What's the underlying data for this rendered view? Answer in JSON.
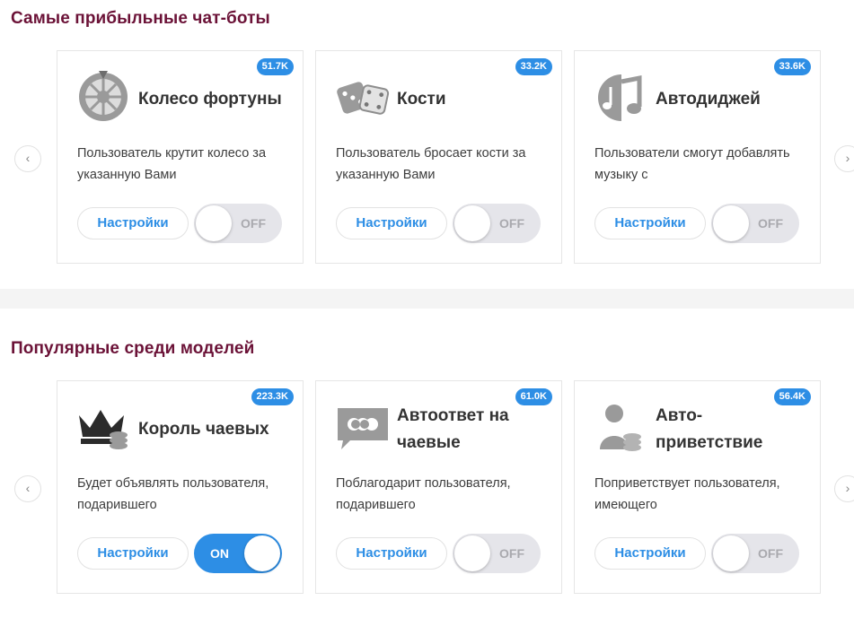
{
  "sections": [
    {
      "title": "Самые прибыльные чат-боты",
      "cards": [
        {
          "icon": "wheel-of-fortune-icon",
          "title": "Колесо фортуны",
          "badge": "51.7K",
          "desc": "Пользователь крутит колесо за указанную Вами",
          "settings": "Настройки",
          "toggle": "OFF",
          "state": false
        },
        {
          "icon": "dice-icon",
          "title": "Кости",
          "badge": "33.2K",
          "desc": "Пользователь бросает кости за указанную Вами",
          "settings": "Настройки",
          "toggle": "OFF",
          "state": false
        },
        {
          "icon": "music-note-icon",
          "title": "Автодиджей",
          "badge": "33.6K",
          "desc": "Пользователи смогут добавлять музыку с",
          "settings": "Настройки",
          "toggle": "OFF",
          "state": false
        }
      ]
    },
    {
      "title": "Популярные среди моделей",
      "cards": [
        {
          "icon": "crown-coins-icon",
          "title": "Король чаевых",
          "badge": "223.3K",
          "desc": "Будет объявлять пользователя, подарившего",
          "settings": "Настройки",
          "toggle": "ON",
          "state": true
        },
        {
          "icon": "chat-bubble-icon",
          "title": "Автоответ на чаевые",
          "badge": "61.0K",
          "desc": "Поблагодарит пользователя, подарившего",
          "settings": "Настройки",
          "toggle": "OFF",
          "state": false
        },
        {
          "icon": "user-coins-icon",
          "title": "Авто-приветствие",
          "badge": "56.4K",
          "desc": "Поприветствует пользователя, имеющего",
          "settings": "Настройки",
          "toggle": "OFF",
          "state": false
        }
      ]
    }
  ],
  "nav": {
    "prev": "‹",
    "next": "›"
  }
}
